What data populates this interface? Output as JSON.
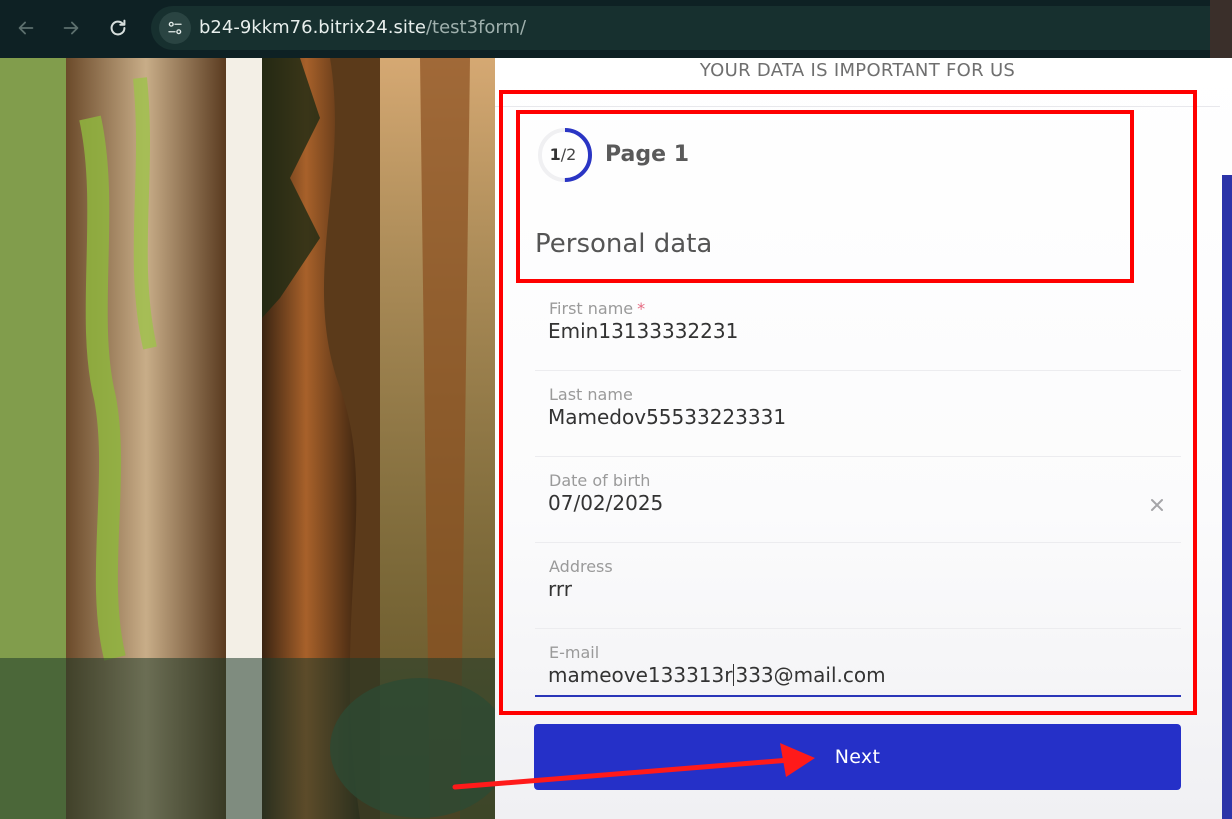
{
  "browser": {
    "url_host": "b24-9kkm76.bitrix24.site",
    "url_path": "/test3form/"
  },
  "form": {
    "header": "YOUR DATA IS IMPORTANT FOR US",
    "progress": {
      "current": "1",
      "total": "/2",
      "fraction": 0.5
    },
    "page_title": "Page 1",
    "section_title": "Personal data",
    "fields": [
      {
        "label": "First name",
        "required_mark": "*",
        "value": "Emin13133332231"
      },
      {
        "label": "Last name",
        "value": "Mamedov55533223331"
      },
      {
        "label": "Date of birth",
        "value": "07/02/2025"
      },
      {
        "label": "Address",
        "value": "rrr"
      },
      {
        "label": "E-mail",
        "value_before_caret": "mameove133313r",
        "value_after_caret": "333@mail.com"
      }
    ],
    "next_label": "Next"
  },
  "colors": {
    "accent": "#2530c8",
    "annotation": "#ff0000",
    "required": "#e56b82"
  }
}
